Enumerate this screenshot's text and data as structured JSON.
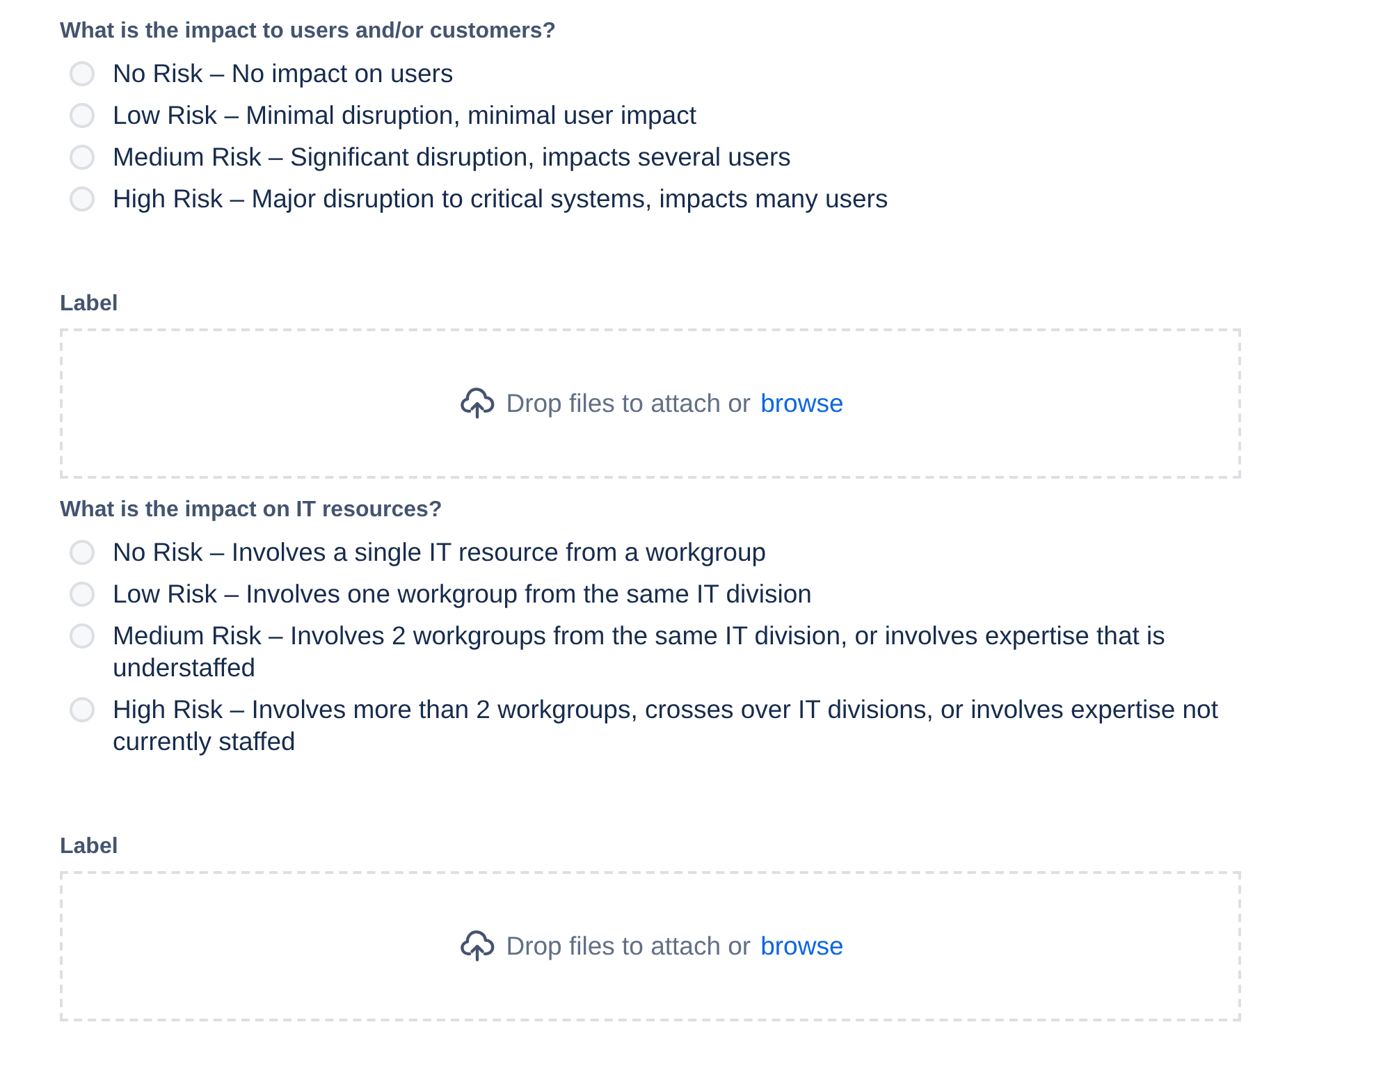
{
  "sections": [
    {
      "kind": "radio-group",
      "question": "What is the impact to users and/or customers?",
      "options": [
        {
          "label": "No Risk – No impact on users",
          "selected": false
        },
        {
          "label": "Low Risk – Minimal disruption, minimal user impact",
          "selected": false
        },
        {
          "label": "Medium Risk – Significant disruption, impacts several users",
          "selected": false
        },
        {
          "label": "High Risk – Major disruption to critical systems, impacts many users",
          "selected": false
        }
      ]
    },
    {
      "kind": "attachment",
      "label": "Label",
      "text": "Drop files to attach or",
      "link": "browse"
    },
    {
      "kind": "radio-group",
      "question": "What is the impact on IT resources?",
      "options": [
        {
          "label": "No Risk – Involves a single IT resource from a workgroup",
          "selected": false
        },
        {
          "label": "Low Risk – Involves one workgroup from the same IT division",
          "selected": false
        },
        {
          "label": "Medium Risk – Involves 2 workgroups from the same IT division, or involves expertise that is understaffed",
          "selected": false
        },
        {
          "label": "High Risk – Involves more than 2 workgroups, crosses over IT divisions, or involves expertise not currently staffed",
          "selected": false
        }
      ]
    },
    {
      "kind": "attachment",
      "label": "Label",
      "text": "Drop files to attach or",
      "link": "browse"
    }
  ]
}
